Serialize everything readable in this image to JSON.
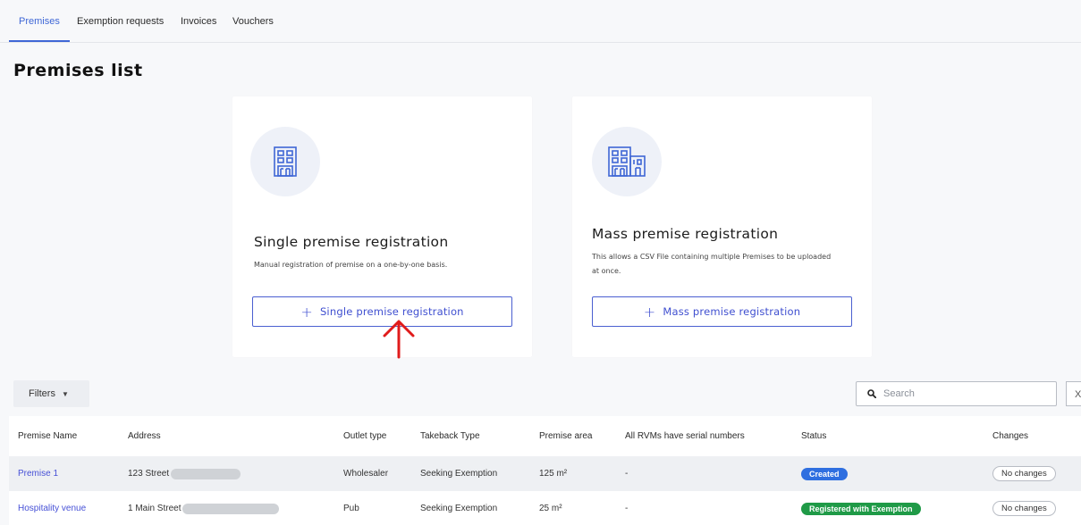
{
  "tabs": [
    {
      "label": "Premises",
      "active": true
    },
    {
      "label": "Exemption requests",
      "active": false
    },
    {
      "label": "Invoices",
      "active": false
    },
    {
      "label": "Vouchers",
      "active": false
    }
  ],
  "page_title": "Premises list",
  "cards": {
    "single": {
      "icon": "building-icon",
      "title": "Single premise registration",
      "description": "Manual registration of premise on a one-by-one basis.",
      "button_label": "Single premise registration"
    },
    "mass": {
      "icon": "buildings-icon",
      "title": "Mass premise registration",
      "description": "This allows a CSV File containing multiple Premises to be uploaded at once.",
      "button_label": "Mass premise registration"
    }
  },
  "filters": {
    "label": "Filters"
  },
  "search": {
    "placeholder": "Search",
    "value": ""
  },
  "close_label": "X",
  "table": {
    "headers": [
      "Premise Name",
      "Address",
      "Outlet type",
      "Takeback Type",
      "Premise area",
      "All RVMs have serial numbers",
      "Status",
      "Changes"
    ],
    "rows": [
      {
        "name": "Premise 1",
        "address": "123 Street",
        "outlet": "Wholesaler",
        "takeback": "Seeking Exemption",
        "area": "125 m²",
        "rvms": "-",
        "status": "Created",
        "status_color": "#2f6fe0",
        "changes": "No changes"
      },
      {
        "name": "Hospitality venue",
        "address": "1 Main Street",
        "outlet": "Pub",
        "takeback": "Seeking Exemption",
        "area": "25 m²",
        "rvms": "-",
        "status": "Registered with Exemption",
        "status_color": "#1f9a47",
        "changes": "No changes"
      }
    ]
  },
  "colors": {
    "accent": "#3f67d6",
    "annotation_arrow": "#e01b1b"
  }
}
